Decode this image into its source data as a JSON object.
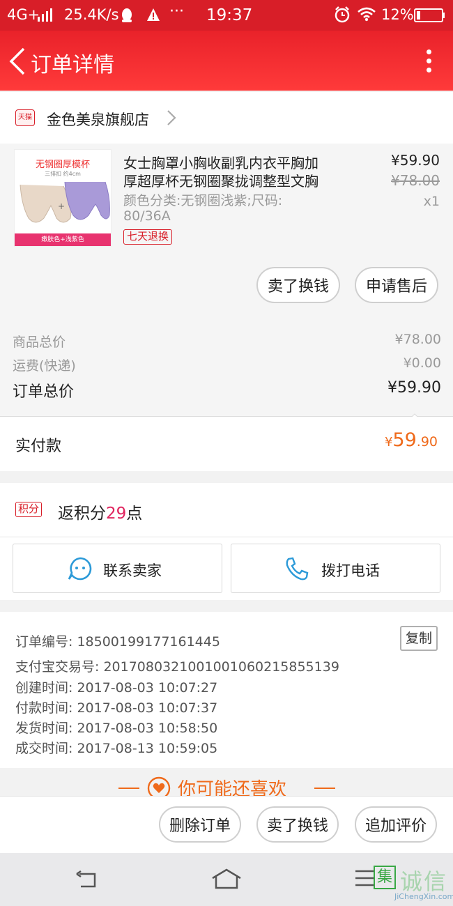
{
  "status_bar": {
    "network": "4G+",
    "speed": "25.4K/s",
    "more": "···",
    "time": "19:37",
    "battery": "12%"
  },
  "app_bar": {
    "title": "订单详情"
  },
  "shop": {
    "badge": "天猫",
    "name": "金色美泉旗舰店"
  },
  "product": {
    "image_title": "无钢圈厚模杯",
    "image_sub": "三排扣 约4cm",
    "image_bottom": "嫩肤色+浅紫色",
    "title_line1": "女士胸罩小胸收副乳内衣平胸加",
    "title_line2": "厚超厚杯无钢圈聚拢调整型文胸",
    "spec_line1": "颜色分类:无钢圈浅紫;尺码:",
    "spec_line2": "80/36A",
    "tag": "七天退换",
    "price": "¥59.90",
    "original_price": "¥78.00",
    "qty": "x1",
    "btn_sell": "卖了换钱",
    "btn_aftersale": "申请售后"
  },
  "summary": {
    "goods_label": "商品总价",
    "goods_value": "¥78.00",
    "shipping_label": "运费(快递)",
    "shipping_value": "¥0.00",
    "order_total_label": "订单总价",
    "order_total_value": "¥59.90",
    "paid_label": "实付款",
    "paid_currency": "¥",
    "paid_int": "59",
    "paid_dec": ".90"
  },
  "points": {
    "badge": "积分",
    "prefix": "返积分",
    "value": "29",
    "suffix": "点"
  },
  "contact": {
    "seller": "联系卖家",
    "call": "拨打电话"
  },
  "order_info": {
    "copy": "复制",
    "rows": [
      "订单编号: 18500199177161445",
      "支付宝交易号: 2017080321001001060215855139",
      "创建时间: 2017-08-03 10:07:27",
      "付款时间: 2017-08-03 10:07:37",
      "发货时间: 2017-08-03 10:58:50",
      "成交时间: 2017-08-13 10:59:05"
    ]
  },
  "recommend": {
    "title": "你可能还喜欢"
  },
  "bottom_actions": {
    "delete": "删除订单",
    "sell": "卖了换钱",
    "review": "追加评价"
  },
  "watermark": {
    "cn": "诚信",
    "en": "JiChengXin.com"
  },
  "colors": {
    "brand_red": "#d81e28",
    "price_orange": "#ef6a1b",
    "points_pink": "#e0245e",
    "icon_blue": "#2c9ad8"
  }
}
